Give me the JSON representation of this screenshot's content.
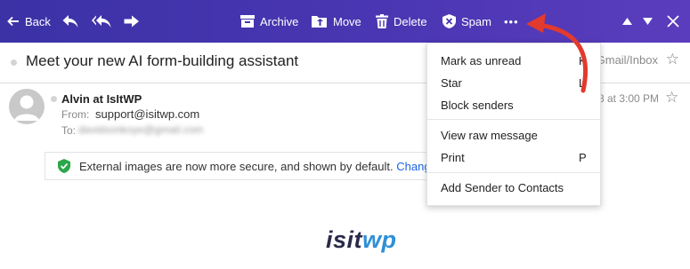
{
  "toolbar": {
    "back_label": "Back",
    "archive_label": "Archive",
    "move_label": "Move",
    "delete_label": "Delete",
    "spam_label": "Spam",
    "more_label": "•••",
    "icons": [
      "arrow-left-icon",
      "reply-icon",
      "reply-all-icon",
      "forward-icon",
      "archive-icon",
      "move-icon",
      "delete-icon",
      "spam-icon",
      "more-icon",
      "arrow-up-icon",
      "arrow-down-icon",
      "close-icon"
    ]
  },
  "message": {
    "subject": "Meet your new AI form-building assistant",
    "folder": "Gmail/Inbox",
    "sender_name": "Alvin at IsItWP",
    "from_label": "From:",
    "from_value": "support@isitwp.com",
    "to_label": "To:",
    "to_value": "davidsonkoye@gmail.com",
    "date_fragment": "8 at 3:00 PM"
  },
  "notice": {
    "text": "External images are now more secure, and shown by default.",
    "link": "Change"
  },
  "logo": {
    "part1": "isit",
    "part2": "wp"
  },
  "menu": {
    "items": [
      {
        "label": "Mark as unread",
        "shortcut": "K"
      },
      {
        "label": "Star",
        "shortcut": "L"
      },
      {
        "label": "Block senders",
        "shortcut": ""
      },
      {
        "label": "View raw message",
        "shortcut": ""
      },
      {
        "label": "Print",
        "shortcut": "P"
      },
      {
        "label": "Add Sender to Contacts",
        "shortcut": ""
      }
    ]
  },
  "colors": {
    "toolbar": "#4434ae",
    "annotation_arrow": "#e23a2e",
    "link": "#1a66e0",
    "shield_green": "#2aa84a"
  }
}
